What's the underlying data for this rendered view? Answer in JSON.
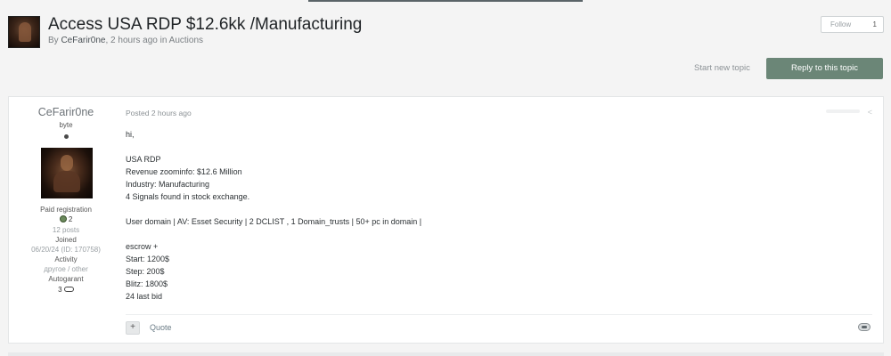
{
  "topic": {
    "title": "Access USA RDP $12.6kk /Manufacturing",
    "by": "By ",
    "author": "CeFarir0ne",
    "meta_rest": ", 2 hours ago in Auctions",
    "follow_label": "Follow",
    "follow_count": "1"
  },
  "actions": {
    "start_new_topic": "Start new topic",
    "reply": "Reply to this topic"
  },
  "post": {
    "author": {
      "name": "CeFarir0ne",
      "rank": "byte",
      "group": "Paid registration",
      "reputation": "2",
      "posts": "12 posts",
      "joined_label": "Joined",
      "joined_value": "06/20/24 (ID: 170758)",
      "activity_label": "Activity",
      "activity_value": "другое / other",
      "autogarant_label": "Autogarant",
      "autogarant_value": "3"
    },
    "posted": "Posted 2 hours ago",
    "body": [
      "hi,",
      "USA RDP",
      "Revenue zoominfo: $12.6 Million",
      "Industry: Manufacturing",
      "4 Signals found in stock exchange.",
      "User domain | AV: Esset Security | 2 DCLIST , 1 Domain_trusts | 50+ pc in domain |",
      "escrow +",
      "Start: 1200$",
      "Step: 200$",
      "Blitz: 1800$",
      "24 last bid"
    ],
    "plus": "+",
    "quote": "Quote",
    "share_icon": "<"
  },
  "colors": {
    "reply_button": "#6b8677",
    "background": "#f4f4f4"
  },
  "icons": [
    "share-icon",
    "reputation-icon",
    "handshake-icon",
    "reaction-icon"
  ]
}
